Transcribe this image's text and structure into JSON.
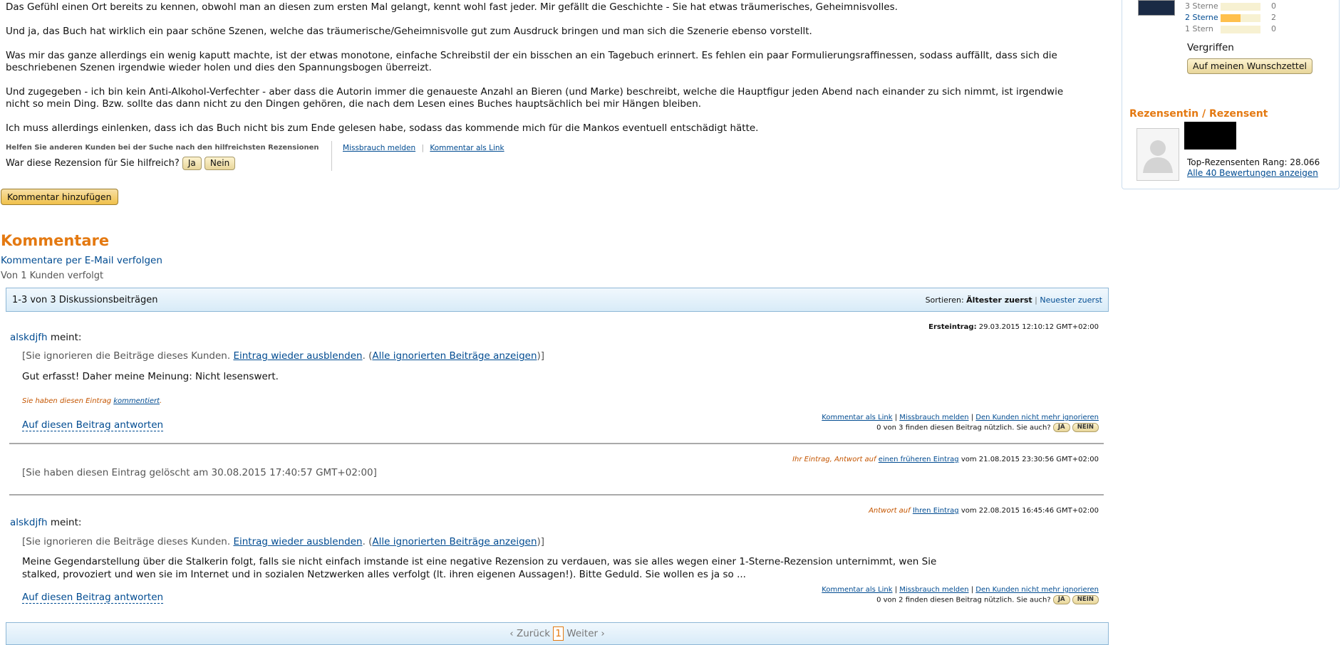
{
  "review": {
    "paragraphs": [
      "Das Gefühl einen Ort bereits zu kennen, obwohl man an diesen zum ersten Mal gelangt, kennt wohl fast jeder. Mir gefällt die Geschichte - Sie hat etwas träumerisches, Geheimnisvolles.",
      "Und ja, das Buch hat wirklich ein paar schöne Szenen, welche das träumerische/Geheimnisvolle gut zum Ausdruck bringen und man sich die Szenerie ebenso vorstellt.",
      "Was mir das ganze allerdings ein wenig kaputt machte, ist der etwas monotone, einfache Schreibstil der ein bisschen an ein Tagebuch erinnert. Es fehlen ein paar Formulierungsraffinessen, sodass auffällt, dass sich die beschriebenen Szenen irgendwie wieder holen und dies den Spannungsbogen überreizt.",
      "Und zugegeben - ich bin kein Anti-Alkohol-Verfechter - aber dass die Autorin immer die genaueste Anzahl an Bieren (und Marke) beschreibt, welche die Hauptfigur jeden Abend nach einander zu sich nimmt, ist irgendwie nicht so mein Ding. Bzw. sollte das dann nicht zu den Dingen gehören, die nach dem Lesen eines Buches hauptsächlich bei mir Hängen bleiben.",
      "Ich muss allerdings einlenken, dass ich das Buch nicht bis zum Ende gelesen habe, sodass das kommende mich für die Mankos eventuell entschädigt hätte."
    ],
    "help_hint": "Helfen Sie anderen Kunden bei der Suche nach den hilfreichsten Rezensionen",
    "helpful_question": "War diese Rezension für Sie hilfreich?",
    "yes": "Ja",
    "no": "Nein",
    "report": "Missbrauch melden",
    "comment_link": "Kommentar als Link",
    "add_comment": "Kommentar hinzufügen"
  },
  "sidebar": {
    "stars": [
      {
        "label": "3 Sterne",
        "count": "0",
        "fill": 0.0,
        "link": false
      },
      {
        "label": "2 Sterne",
        "count": "2",
        "fill": 0.5,
        "link": true
      },
      {
        "label": "1 Stern",
        "count": "0",
        "fill": 0.0,
        "link": false
      }
    ],
    "status": "Vergriffen",
    "wishlist": "Auf meinen Wunschzettel",
    "reviewer_heading": "Rezensentin / Rezensent",
    "rank": "Top-Rezensenten Rang: 28.066",
    "all_reviews": "Alle 40 Bewertungen anzeigen"
  },
  "comments": {
    "heading": "Kommentare",
    "follow": "Kommentare per E-Mail verfolgen",
    "followers": "Von 1 Kunden verfolgt",
    "count": "1-3 von 3 Diskussionsbeiträgen",
    "sort_label": "Sortieren:",
    "sort_active": "Ältester zuerst",
    "sort_other": "Neuester zuerst",
    "sep": "|",
    "posts": [
      {
        "author": "alskdjfh",
        "says": "meint:",
        "meta_label": "Ersteintrag:",
        "meta_date": "29.03.2015 12:10:12 GMT+02:00",
        "ignored_prefix": "[Sie ignorieren die Beiträge dieses Kunden.",
        "hide": "Eintrag wieder ausblenden",
        "show_open": ".  (",
        "show_all": "Alle ignorierten Beiträge anzeigen",
        "show_close": ")]",
        "text": "Gut erfasst! Daher meine Meinung: Nicht lesenswert.",
        "commented_prefix": "Sie haben diesen Eintrag",
        "commented_link": "kommentiert",
        "commented_suffix": ".",
        "reply": "Auf diesen Beitrag antworten",
        "link": "Kommentar als Link",
        "report": "Missbrauch melden",
        "unignore": "Den Kunden nicht mehr ignorieren",
        "useful": "0 von 3 finden diesen Beitrag nützlich. Sie auch?",
        "yes": "JA",
        "no": "NEIN"
      },
      {
        "meta_prefix": "Ihr Eintrag, Antwort auf",
        "meta_link": "einen früheren Eintrag",
        "meta_suffix": "vom 21.08.2015 23:30:56 GMT+02:00",
        "deleted": "[Sie haben diesen Eintrag gelöscht am 30.08.2015 17:40:57 GMT+02:00]"
      },
      {
        "author": "alskdjfh",
        "says": "meint:",
        "meta_prefix": "Antwort auf",
        "meta_link": "Ihren Eintrag",
        "meta_suffix": "vom 22.08.2015 16:45:46 GMT+02:00",
        "ignored_prefix": "[Sie ignorieren die Beiträge dieses Kunden.",
        "hide": "Eintrag wieder ausblenden",
        "show_open": ".  (",
        "show_all": "Alle ignorierten Beiträge anzeigen",
        "show_close": ")]",
        "text_line1": "Meine Gegendarstellung über die Stalkerin folgt, falls sie nicht einfach imstande ist eine negative Rezension zu verdauen, was sie alles wegen einer 1-Sterne-Rezension unternimmt, wen Sie",
        "text_line2": "stalked, provoziert und wen sie im Internet und in sozialen Netzwerken alles verfolgt (lt. ihren eigenen Aussagen!). Bitte Geduld. Sie wollen es ja so ...",
        "reply": "Auf diesen Beitrag antworten",
        "link": "Kommentar als Link",
        "report": "Missbrauch melden",
        "unignore": "Den Kunden nicht mehr ignorieren",
        "useful": "0 von 2 finden diesen Beitrag nützlich. Sie auch?",
        "yes": "JA",
        "no": "NEIN"
      }
    ],
    "pager": {
      "prev": "‹ Zurück",
      "current": "1",
      "next": "Weiter ›"
    }
  }
}
